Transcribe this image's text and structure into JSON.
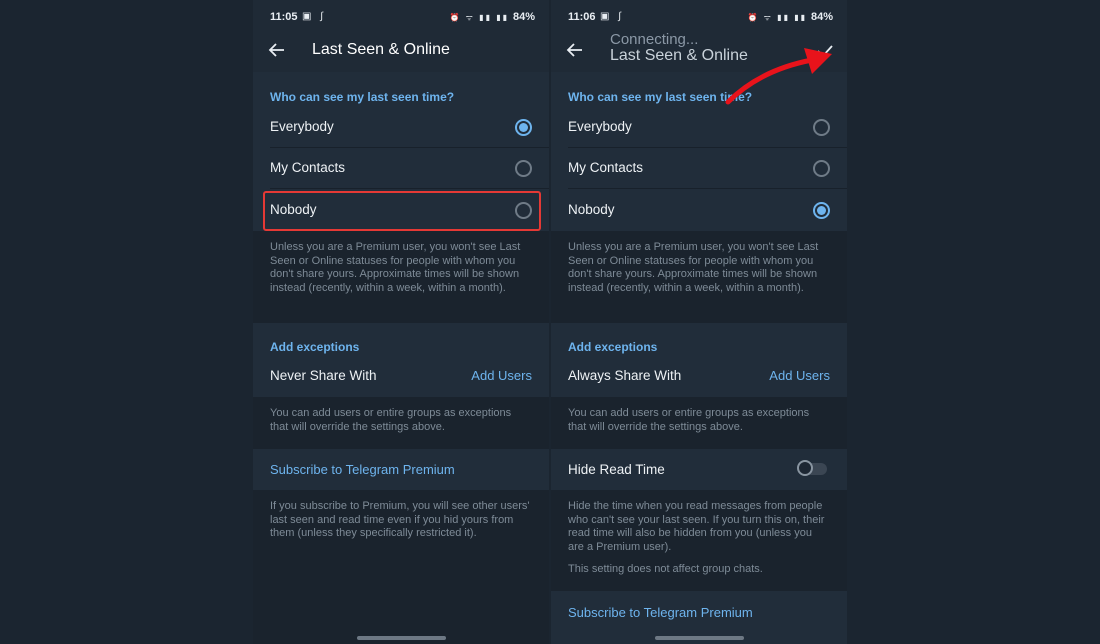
{
  "left": {
    "status": {
      "time": "11:05",
      "battery": "84%"
    },
    "appbar": {
      "title": "Last Seen & Online"
    },
    "section_title": "Who can see my last seen time?",
    "options": [
      {
        "label": "Everybody",
        "selected": true
      },
      {
        "label": "My Contacts",
        "selected": false
      },
      {
        "label": "Nobody",
        "selected": false
      }
    ],
    "info": "Unless you are a Premium user, you won't see Last Seen or Online statuses for people with whom you don't share yours. Approximate times will be shown instead (recently, within a week, within a month).",
    "exceptions_title": "Add exceptions",
    "exception_label": "Never Share With",
    "add_users": "Add Users",
    "exceptions_info": "You can add users or entire groups as exceptions that will override the settings above.",
    "premium_link": "Subscribe to Telegram Premium",
    "premium_info": "If you subscribe to Premium, you will see other users' last seen and read time even if you hid yours from them (unless they specifically restricted it)."
  },
  "right": {
    "status": {
      "time": "11:06",
      "battery": "84%"
    },
    "appbar": {
      "connecting": "Connecting...",
      "title": "Last Seen & Online"
    },
    "section_title": "Who can see my last seen time?",
    "options": [
      {
        "label": "Everybody",
        "selected": false
      },
      {
        "label": "My Contacts",
        "selected": false
      },
      {
        "label": "Nobody",
        "selected": true
      }
    ],
    "info": "Unless you are a Premium user, you won't see Last Seen or Online statuses for people with whom you don't share yours. Approximate times will be shown instead (recently, within a week, within a month).",
    "exceptions_title": "Add exceptions",
    "exception_label": "Always Share With",
    "add_users": "Add Users",
    "exceptions_info": "You can add users or entire groups as exceptions that will override the settings above.",
    "hide_read_time": "Hide Read Time",
    "hide_read_info": "Hide the time when you read messages from people who can't see your last seen. If you turn this on, their read time will also be hidden from you (unless you are a Premium user).",
    "hide_read_note": "This setting does not affect group chats.",
    "premium_link": "Subscribe to Telegram Premium"
  },
  "colors": {
    "accent": "#6eb4ee",
    "highlight": "#e53935",
    "arrow": "#e8131b"
  },
  "icons": [
    "back-arrow-icon",
    "check-icon",
    "radio-icon",
    "toggle-icon"
  ]
}
